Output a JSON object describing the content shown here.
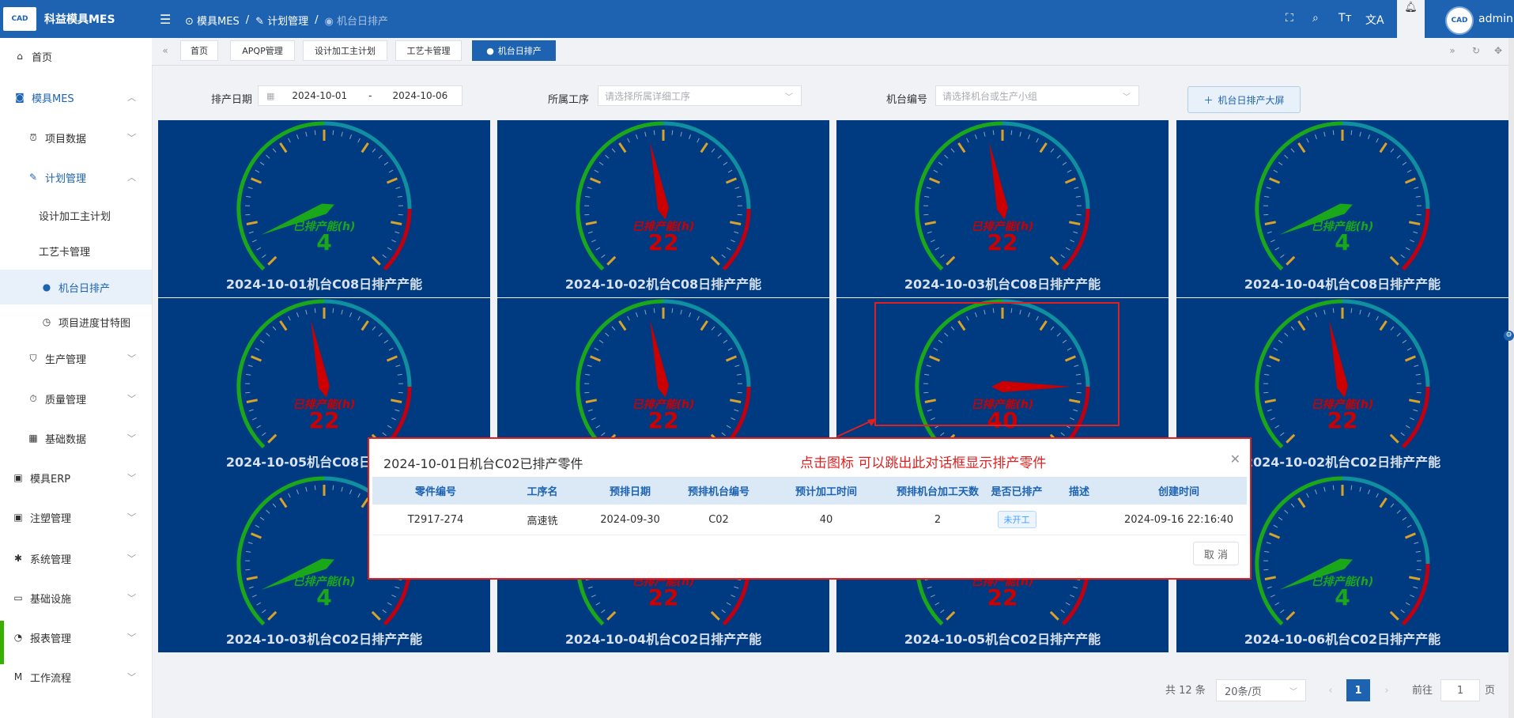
{
  "app": {
    "title": "科益模具MES",
    "logo_text": "CAD"
  },
  "breadcrumb": [
    "模具MES",
    "计划管理",
    "机台日排产"
  ],
  "user": {
    "name": "admin"
  },
  "sidebar": {
    "items": [
      {
        "label": "首页",
        "icon": "home-icon"
      },
      {
        "label": "模具MES",
        "icon": "camera-icon"
      },
      {
        "label": "项目数据",
        "icon": "alarm-icon"
      },
      {
        "label": "计划管理",
        "icon": "edit-icon"
      },
      {
        "label": "设计加工主计划",
        "icon": ""
      },
      {
        "label": "工艺卡管理",
        "icon": ""
      },
      {
        "label": "机台日排产",
        "icon": "user-icon"
      },
      {
        "label": "项目进度甘特图",
        "icon": "clock-icon"
      },
      {
        "label": "生产管理",
        "icon": "cart-icon"
      },
      {
        "label": "质量管理",
        "icon": "stopwatch-icon"
      },
      {
        "label": "基础数据",
        "icon": "calendar-icon"
      },
      {
        "label": "模具ERP",
        "icon": "suitcase-icon"
      },
      {
        "label": "注塑管理",
        "icon": "suitcase-icon"
      },
      {
        "label": "系统管理",
        "icon": "gear-icon"
      },
      {
        "label": "基础设施",
        "icon": "monitor-icon"
      },
      {
        "label": "报表管理",
        "icon": "pie-icon"
      },
      {
        "label": "工作流程",
        "icon": "flow-icon"
      }
    ]
  },
  "tabs": [
    "首页",
    "APQP管理",
    "设计加工主计划",
    "工艺卡管理",
    "机台日排产"
  ],
  "filters": {
    "date_label": "排产日期",
    "date_start": "2024-10-01",
    "date_sep": "-",
    "date_end": "2024-10-06",
    "process_label": "所属工序",
    "process_placeholder": "请选择所属详细工序",
    "machine_label": "机台编号",
    "machine_placeholder": "请选择机台或生产小组",
    "screen_button": "机台日排产大屏"
  },
  "gauge_label": "已排产能(h)",
  "gauges": [
    {
      "caption": "2024-10-01机台C08日排产产能",
      "value": 4,
      "level": "green"
    },
    {
      "caption": "2024-10-02机台C08日排产产能",
      "value": 22,
      "level": "red"
    },
    {
      "caption": "2024-10-03机台C08日排产产能",
      "value": 22,
      "level": "red"
    },
    {
      "caption": "2024-10-04机台C08日排产产能",
      "value": 4,
      "level": "green"
    },
    {
      "caption": "2024-10-05机台C08日排产产能",
      "value": 22,
      "level": "red"
    },
    {
      "caption": "",
      "value": 22,
      "level": "red"
    },
    {
      "caption": "",
      "value": 40,
      "level": "red"
    },
    {
      "caption": "2024-10-02机台C02日排产产能",
      "value": 22,
      "level": "red"
    },
    {
      "caption": "2024-10-03机台C02日排产产能",
      "value": 4,
      "level": "green"
    },
    {
      "caption": "2024-10-04机台C02日排产产能",
      "value": 22,
      "level": "red"
    },
    {
      "caption": "2024-10-05机台C02日排产产能",
      "value": 22,
      "level": "red"
    },
    {
      "caption": "2024-10-06机台C02日排产产能",
      "value": 4,
      "level": "green"
    }
  ],
  "pagination": {
    "total": "共 12 条",
    "page_size": "20条/页",
    "current": "1",
    "goto_label": "前往",
    "goto_value": "1",
    "page_suffix": "页"
  },
  "dialog": {
    "title": "2024-10-01日机台C02已排产零件",
    "note": "点击图标 可以跳出此对话框显示排产零件",
    "columns": [
      "零件编号",
      "工序名",
      "预排日期",
      "预排机台编号",
      "预计加工时间",
      "预排机台加工天数",
      "是否已排产",
      "描述",
      "创建时间"
    ],
    "rows": [
      [
        "T2917-274",
        "高速铣",
        "2024-09-30",
        "C02",
        "40",
        "2",
        "未开工",
        "",
        "2024-09-16 22:16:40"
      ]
    ],
    "cancel": "取 消"
  },
  "colors": {
    "brand": "#1d63b1",
    "gauge_bg": "#003a80",
    "highlight": "#e02020",
    "green": "#1aa81a",
    "red": "#cc0000"
  }
}
